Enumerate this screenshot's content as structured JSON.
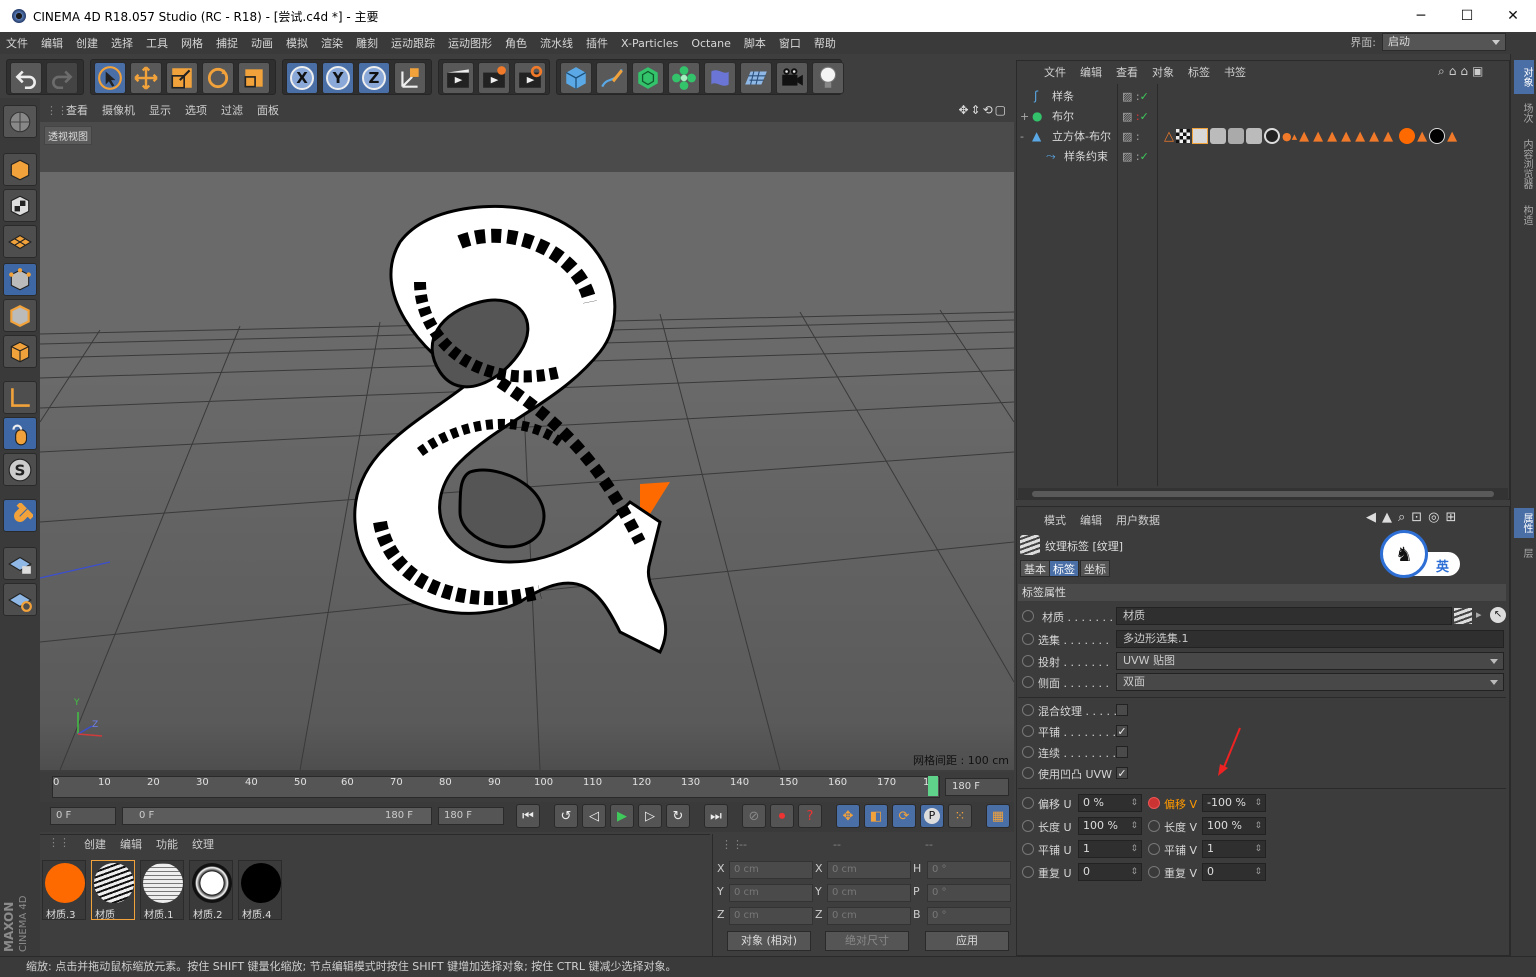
{
  "window": {
    "title": "CINEMA 4D R18.057 Studio (RC - R18) - [尝试.c4d *] - 主要",
    "minimize": "─",
    "maximize": "☐",
    "close": "✕"
  },
  "menubar": {
    "items": [
      "文件",
      "编辑",
      "创建",
      "选择",
      "工具",
      "网格",
      "捕捉",
      "动画",
      "模拟",
      "渲染",
      "雕刻",
      "运动跟踪",
      "运动图形",
      "角色",
      "流水线",
      "插件",
      "X-Particles",
      "Octane",
      "脚本",
      "窗口",
      "帮助"
    ],
    "layout_label": "界面:",
    "layout_value": "启动"
  },
  "toolbar": {
    "x_label": "X",
    "y_label": "Y",
    "z_label": "Z"
  },
  "viewport": {
    "menu": [
      "查看",
      "摄像机",
      "显示",
      "选项",
      "过滤",
      "面板"
    ],
    "view_name": "透视视图",
    "grid_info": "网格间距 : 100 cm",
    "axis_y": "Y",
    "axis_z": "Z"
  },
  "timeline": {
    "ticks": [
      "0",
      "10",
      "20",
      "30",
      "40",
      "50",
      "60",
      "70",
      "80",
      "90",
      "100",
      "110",
      "120",
      "130",
      "140",
      "150",
      "160",
      "170",
      "1"
    ],
    "end_field": "180 F",
    "current_frame": "0 F",
    "range_start": "0 F",
    "range_end": "180 F",
    "max_frame": "180 F"
  },
  "material_manager": {
    "menu": [
      "创建",
      "编辑",
      "功能",
      "纹理"
    ],
    "materials": [
      {
        "name": "材质.3",
        "color": "#ff6a00"
      },
      {
        "name": "材质",
        "color": "#e0e0e0"
      },
      {
        "name": "材质.1",
        "color": "#d8d8d8"
      },
      {
        "name": "材质.2",
        "color": "#ffffff"
      },
      {
        "name": "材质.4",
        "color": "#000000"
      }
    ]
  },
  "coordinates": {
    "header": [
      "--",
      "--",
      "--"
    ],
    "rows": [
      {
        "a": "X",
        "av": "0 cm",
        "b": "X",
        "bv": "0 cm",
        "c": "H",
        "cv": "0 °"
      },
      {
        "a": "Y",
        "av": "0 cm",
        "b": "Y",
        "bv": "0 cm",
        "c": "P",
        "cv": "0 °"
      },
      {
        "a": "Z",
        "av": "0 cm",
        "b": "Z",
        "bv": "0 cm",
        "c": "B",
        "cv": "0 °"
      }
    ],
    "mode": "对象 (相对)",
    "size": "绝对尺寸",
    "apply": "应用"
  },
  "object_manager": {
    "menu": [
      "文件",
      "编辑",
      "查看",
      "对象",
      "标签",
      "书签"
    ],
    "objects": [
      {
        "name": "样条",
        "prefix": ""
      },
      {
        "name": "布尔",
        "prefix": "+"
      },
      {
        "name": "立方体-布尔",
        "prefix": "-"
      },
      {
        "name": "样条约束",
        "prefix": ""
      }
    ]
  },
  "attribute_manager": {
    "menu": [
      "模式",
      "编辑",
      "用户数据"
    ],
    "title": "纹理标签 [纹理]",
    "tabs": [
      "基本",
      "标签",
      "坐标"
    ],
    "section": "标签属性",
    "rows": [
      {
        "label": "材质 . . . . . . .",
        "value": "材质"
      },
      {
        "label": "选集 . . . . . . .",
        "value": "多边形选集.1"
      },
      {
        "label": "投射 . . . . . . .",
        "value": "UVW 贴图"
      },
      {
        "label": "侧面 . . . . . . .",
        "value": "双面"
      }
    ],
    "checks": [
      {
        "label": "混合纹理 . . . . .",
        "checked": ""
      },
      {
        "label": "平铺 . . . . . . . .",
        "checked": "✓"
      },
      {
        "label": "连续 . . . . . . . .",
        "checked": ""
      },
      {
        "label": "使用凹凸 UVW",
        "checked": "✓"
      }
    ],
    "params": [
      {
        "l1": "偏移 U",
        "v1": "0 %",
        "l2": "偏移 V",
        "v2": "-100 %"
      },
      {
        "l1": "长度 U",
        "v1": "100 %",
        "l2": "长度 V",
        "v2": "100 %"
      },
      {
        "l1": "平铺 U",
        "v1": "1",
        "l2": "平铺 V",
        "v2": "1"
      },
      {
        "l1": "重复 U",
        "v1": "0",
        "l2": "重复 V",
        "v2": "0"
      }
    ]
  },
  "right_dock": {
    "tabs_top": [
      "对象",
      "场次",
      "内容浏览器",
      "构造"
    ],
    "tabs_bottom": [
      "属性",
      "层"
    ]
  },
  "ime": {
    "label": "英"
  },
  "logo": {
    "maxon": "MAXON",
    "product": "CINEMA 4D"
  },
  "status": "缩放: 点击并拖动鼠标缩放元素。按住 SHIFT 键量化缩放; 节点编辑模式时按住 SHIFT 键增加选择对象; 按住 CTRL 键减少选择对象。",
  "colors": {
    "accent_blue": "#4a6ea6",
    "orange": "#ff6a00",
    "highlight_param": "#ff9900"
  }
}
